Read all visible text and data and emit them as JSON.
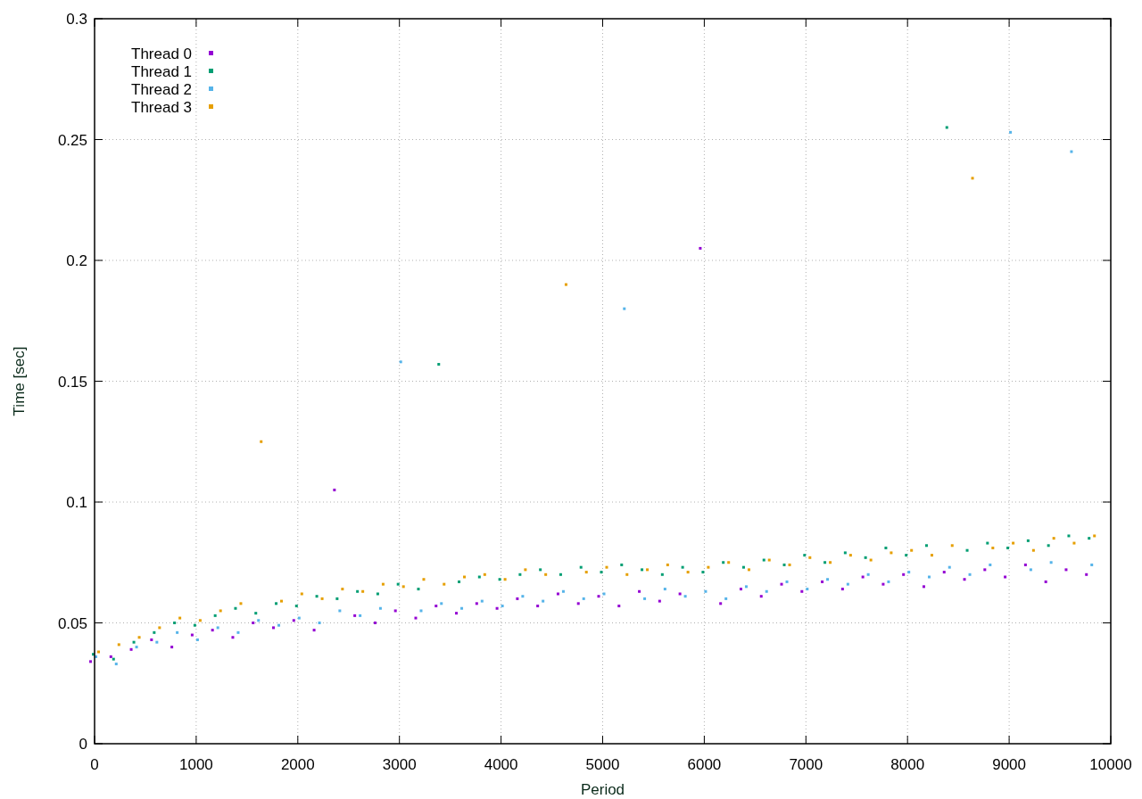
{
  "chart_data": {
    "type": "scatter",
    "xlabel": "Period",
    "ylabel": "Time [sec]",
    "grid": true,
    "legend": true,
    "x": [
      0,
      200,
      400,
      600,
      800,
      1000,
      1200,
      1400,
      1600,
      1800,
      2000,
      2200,
      2400,
      2600,
      2800,
      3000,
      3200,
      3400,
      3600,
      3800,
      4000,
      4200,
      4400,
      4600,
      4800,
      5000,
      5200,
      5400,
      5600,
      5800,
      6000,
      6200,
      6400,
      6600,
      6800,
      7000,
      7200,
      7400,
      7600,
      7800,
      8000,
      8200,
      8400,
      8600,
      8800,
      9000,
      9200,
      9400,
      9600,
      9800
    ],
    "xlim": [
      0,
      10000
    ],
    "ylim": [
      0,
      0.3
    ],
    "xticks": [
      0,
      1000,
      2000,
      3000,
      4000,
      5000,
      6000,
      7000,
      8000,
      9000,
      10000
    ],
    "yticks": [
      {
        "value": 0,
        "label": "0"
      },
      {
        "value": 0.05,
        "label": "0.05"
      },
      {
        "value": 0.1,
        "label": "0.1"
      },
      {
        "value": 0.15,
        "label": "0.15"
      },
      {
        "value": 0.2,
        "label": "0.2"
      },
      {
        "value": 0.25,
        "label": "0.25"
      },
      {
        "value": 0.3,
        "label": "0.3"
      }
    ],
    "series": [
      {
        "name": "Thread 0",
        "color": "#9400d3",
        "values": [
          0.034,
          0.036,
          0.039,
          0.043,
          0.04,
          0.045,
          0.047,
          0.044,
          0.05,
          0.048,
          0.051,
          0.047,
          0.105,
          0.053,
          0.05,
          0.055,
          0.052,
          0.057,
          0.054,
          0.058,
          0.056,
          0.06,
          0.057,
          0.062,
          0.058,
          0.061,
          0.057,
          0.063,
          0.059,
          0.062,
          0.205,
          0.058,
          0.064,
          0.061,
          0.066,
          0.063,
          0.067,
          0.064,
          0.069,
          0.066,
          0.07,
          0.065,
          0.071,
          0.068,
          0.072,
          0.069,
          0.074,
          0.067,
          0.072,
          0.07
        ]
      },
      {
        "name": "Thread 1",
        "color": "#009e73",
        "values": [
          0.037,
          0.035,
          0.042,
          0.046,
          0.05,
          0.049,
          0.053,
          0.056,
          0.054,
          0.058,
          0.057,
          0.061,
          0.06,
          0.063,
          0.062,
          0.066,
          0.064,
          0.157,
          0.067,
          0.069,
          0.068,
          0.07,
          0.072,
          0.07,
          0.073,
          0.071,
          0.074,
          0.072,
          0.07,
          0.073,
          0.071,
          0.075,
          0.073,
          0.076,
          0.074,
          0.078,
          0.075,
          0.079,
          0.077,
          0.081,
          0.078,
          0.082,
          0.255,
          0.08,
          0.083,
          0.081,
          0.084,
          0.082,
          0.086,
          0.085
        ]
      },
      {
        "name": "Thread 2",
        "color": "#56b4e9",
        "values": [
          0.036,
          0.033,
          0.04,
          0.042,
          0.046,
          0.043,
          0.048,
          0.046,
          0.051,
          0.049,
          0.052,
          0.05,
          0.055,
          0.053,
          0.056,
          0.158,
          0.055,
          0.058,
          0.056,
          0.059,
          0.057,
          0.061,
          0.059,
          0.063,
          0.06,
          0.062,
          0.18,
          0.06,
          0.064,
          0.061,
          0.063,
          0.06,
          0.065,
          0.063,
          0.067,
          0.064,
          0.068,
          0.066,
          0.07,
          0.067,
          0.071,
          0.069,
          0.073,
          0.07,
          0.074,
          0.253,
          0.072,
          0.075,
          0.245,
          0.074
        ]
      },
      {
        "name": "Thread 3",
        "color": "#e69f00",
        "values": [
          0.038,
          0.041,
          0.044,
          0.048,
          0.052,
          0.051,
          0.055,
          0.058,
          0.125,
          0.059,
          0.062,
          0.06,
          0.064,
          0.063,
          0.066,
          0.065,
          0.068,
          0.066,
          0.069,
          0.07,
          0.068,
          0.072,
          0.07,
          0.19,
          0.071,
          0.073,
          0.07,
          0.072,
          0.074,
          0.071,
          0.073,
          0.075,
          0.072,
          0.076,
          0.074,
          0.077,
          0.075,
          0.078,
          0.076,
          0.079,
          0.08,
          0.078,
          0.082,
          0.234,
          0.081,
          0.083,
          0.08,
          0.085,
          0.083,
          0.086
        ]
      }
    ]
  }
}
